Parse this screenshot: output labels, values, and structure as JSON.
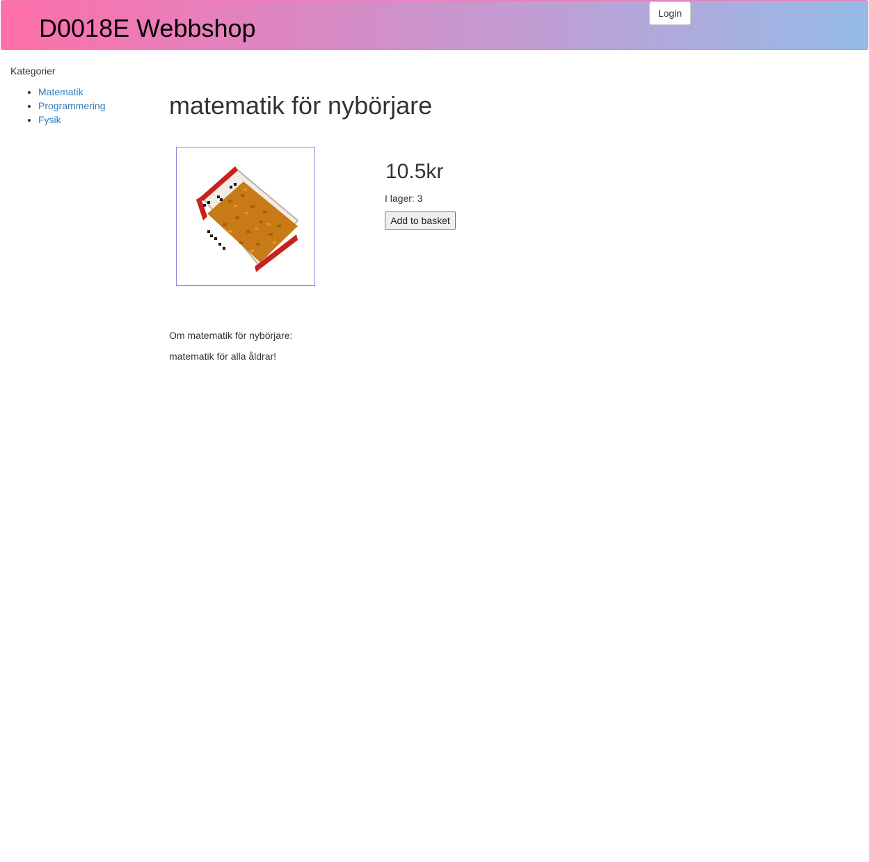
{
  "header": {
    "site_title": "D0018E Webbshop",
    "login_label": "Login"
  },
  "sidebar": {
    "title": "Kategorier",
    "items": [
      {
        "label": "Matematik"
      },
      {
        "label": "Programmering"
      },
      {
        "label": "Fysik"
      }
    ]
  },
  "product": {
    "title": "matematik för nybörjare",
    "image_icon": "book-icon",
    "price": "10.5kr",
    "stock": "I lager: 3",
    "basket_label": "Add to basket",
    "about_heading": "Om matematik för nybörjare:",
    "description": "matematik för alla åldrar!"
  },
  "colors": {
    "header_gradient_start": "#ff6fa9",
    "header_gradient_end": "#95bbe7",
    "link": "#337ab7",
    "image_border": "#8c86d6"
  }
}
